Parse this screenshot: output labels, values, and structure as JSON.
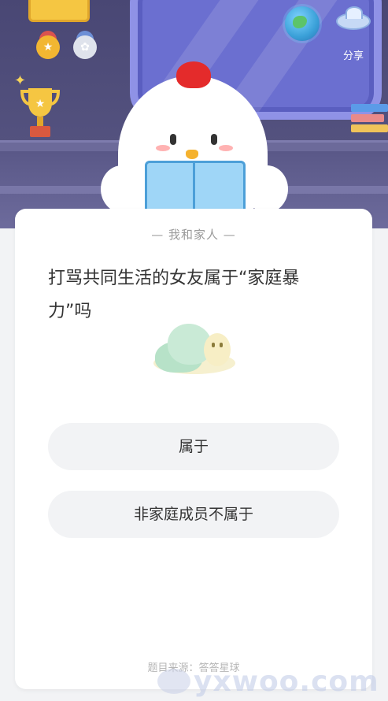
{
  "header": {
    "share_label": "分享"
  },
  "card": {
    "category": "— 我和家人 —",
    "question": "打骂共同生活的女友属于“家庭暴力”吗",
    "options": [
      {
        "label": "属于"
      },
      {
        "label": "非家庭成员不属于"
      }
    ],
    "source": "题目来源：答答星球"
  },
  "watermark": {
    "text": "yxwoo.com"
  },
  "colors": {
    "header_bg": "#4b4a78",
    "card_bg": "#ffffff",
    "option_bg": "#f2f3f5",
    "comb_red": "#e42b2b"
  }
}
